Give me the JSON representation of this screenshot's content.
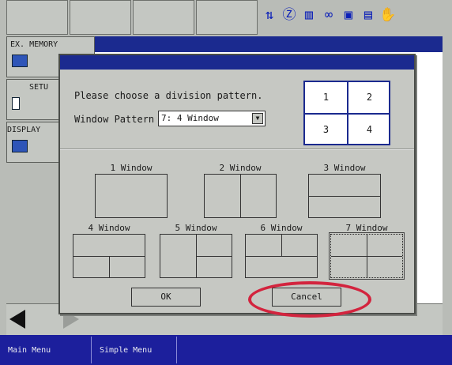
{
  "status_icons": [
    "12",
    "Z",
    "bar",
    "link",
    "net",
    "page",
    "hand"
  ],
  "side_buttons": [
    {
      "label": "EX. MEMORY"
    },
    {
      "label": "SETU"
    },
    {
      "label": "DISPLAY"
    }
  ],
  "bottom_menu": [
    "Main Menu",
    "Simple Menu"
  ],
  "dialog": {
    "prompt": "Please choose a division pattern.",
    "window_pattern_label": "Window Pattern",
    "window_pattern_value": "7: 4 Window",
    "preview_cells": [
      "1",
      "2",
      "3",
      "4"
    ],
    "options": [
      "1 Window",
      "2 Window",
      "3 Window",
      "4 Window",
      "5 Window",
      "6 Window",
      "7 Window"
    ],
    "selected_option": "7 Window",
    "ok_label": "OK",
    "cancel_label": "Cancel"
  },
  "colors": {
    "dialog_bg": "#c6c8c3",
    "title_bar": "#1b2a8f",
    "annotation_ring": "#d3243e"
  }
}
